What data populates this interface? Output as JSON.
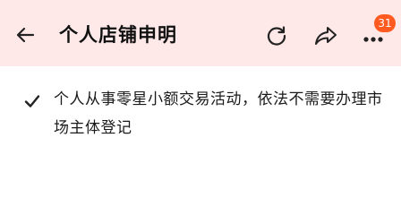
{
  "header": {
    "title": "个人店铺申明",
    "back_icon": "back-arrow-icon",
    "refresh_icon": "refresh-icon",
    "share_icon": "share-icon",
    "more_icon": "more-dots-icon",
    "badge_count": "31",
    "background_color": "#ffe8e8",
    "badge_color": "#ff5a1f"
  },
  "content": {
    "check_icon": "check-icon",
    "statement": "个人从事零星小额交易活动，依法不需要办理市场主体登记"
  }
}
